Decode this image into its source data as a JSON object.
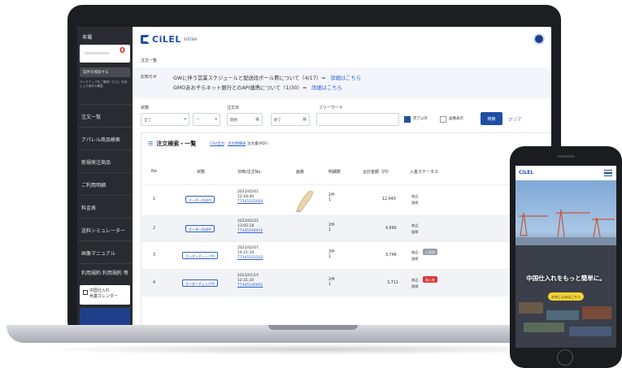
{
  "sidebar": {
    "top_label": "市場",
    "card_count": "0",
    "search_label": "案件を検索する",
    "note": "ランクアップをご確認ください お気に入り案件の確認",
    "menu": [
      "注文一覧",
      "アパレル商品検索",
      "新規発注商品",
      "ご利用明細",
      "料金表",
      "送料シミュレーター",
      "画像マニュアル",
      "利用規約 利用規約 等"
    ],
    "calendar_label_1": "中国仕入れ",
    "calendar_label_2": "休業カレンダー"
  },
  "header": {
    "logo": "CiLEL",
    "logo_sub": "SYSTEM"
  },
  "breadcrumb": "注文一覧",
  "notice": {
    "label": "お知らせ",
    "items": [
      {
        "text": "GWに伴う営業スケジュールと配送段ボール費について（4/17）⇒",
        "link": "詳細はこちら"
      },
      {
        "text": "GMOあおぞらネット銀行とのAPI連携について（1/30）⇒",
        "link": "詳細はこちら"
      }
    ]
  },
  "filters": {
    "status_label": "状態",
    "status_value": "全て",
    "sub_value": "—",
    "date_label": "注文日",
    "date_from": "開始",
    "date_to": "終了",
    "keyword_label": "フリーワード",
    "chk1": "完了以外",
    "chk2": "画像表示",
    "search_btn": "検索",
    "clear": "クリア"
  },
  "panel": {
    "title": "注文検索・一覧",
    "link1": "CSV出力",
    "link2": "注文明細表",
    "text": "注文書(PDF)"
  },
  "table": {
    "headers": [
      "No",
      "状態",
      "日時/注文No.",
      "画像",
      "明細数",
      "合計金額（円）",
      "入金ステータス"
    ],
    "rows": [
      {
        "no": "1",
        "status": "オーダー作成中",
        "date": "2023/05/01",
        "time": "12:18:40",
        "order": "T7345105000",
        "qty_a": "2件",
        "qty_b": "1",
        "amount": "12,040",
        "pay1": "商品",
        "pay2": "国際",
        "badge": "",
        "badge_color": ""
      },
      {
        "no": "2",
        "status": "オーダー作成中",
        "date": "2023/02/22",
        "time": "13:05:18",
        "order": "T7345104912",
        "qty_a": "2件",
        "qty_b": "1",
        "amount": "4,690",
        "pay1": "商品",
        "pay2": "国際",
        "badge": "",
        "badge_color": ""
      },
      {
        "no": "3",
        "status": "オーダーチェック中",
        "date": "2023/02/07",
        "time": "14:21:10",
        "order": "T7345103202",
        "qty_a": "3件",
        "qty_b": "1",
        "amount": "3,746",
        "pay1": "商品",
        "pay2": "国際",
        "badge": "入金済",
        "badge_color": "#9aa0a8"
      },
      {
        "no": "4",
        "status": "オーダーチェック中",
        "date": "2023/01/19",
        "time": "12:31:20",
        "order": "T7345100001",
        "qty_a": "2件",
        "qty_b": "1",
        "amount": "3,711",
        "pay1": "商品",
        "pay2": "国際",
        "badge": "未入金",
        "badge_color": "#d83a3a"
      }
    ]
  },
  "phone": {
    "logo": "CiLEL",
    "hero_text": "中国仕入れをもっと簡単に。",
    "cta": "お申し込みはこちら"
  }
}
